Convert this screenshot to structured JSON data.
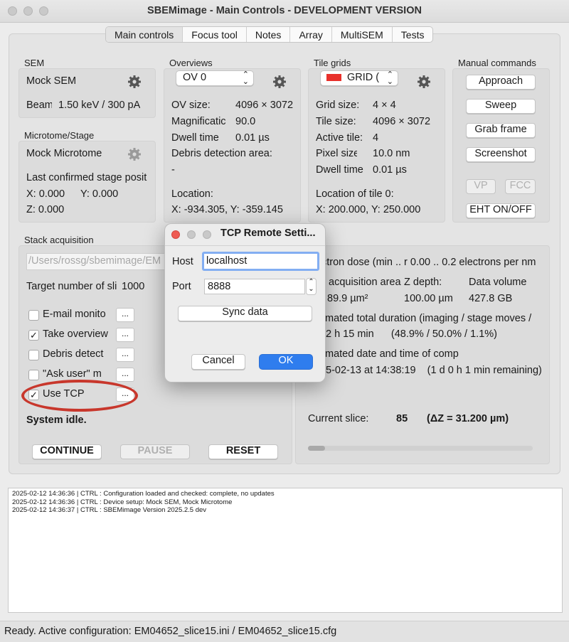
{
  "window": {
    "title": "SBEMimage - Main Controls - DEVELOPMENT VERSION"
  },
  "tabs": [
    "Main controls",
    "Focus tool",
    "Notes",
    "Array",
    "MultiSEM",
    "Tests"
  ],
  "sem": {
    "section_label": "SEM",
    "device": "Mock SEM",
    "beam_label": "Beam",
    "beam_value": "1.50 keV / 300 pA"
  },
  "stage": {
    "section_label": "Microtome/Stage",
    "device": "Mock Microtome",
    "last_pos_label": "Last confirmed stage posit",
    "x": "X: 0.000",
    "y": "Y: 0.000",
    "z": "Z: 0.000"
  },
  "overviews": {
    "section_label": "Overviews",
    "selected": "OV 0",
    "rows": [
      {
        "label": "OV size:",
        "value": "4096 × 3072"
      },
      {
        "label": "Magnificatic",
        "value": "90.0"
      },
      {
        "label": "Dwell time",
        "value": "0.01 µs"
      }
    ],
    "debris_label": "Debris detection area:",
    "debris_value": "-",
    "location_label": "Location:",
    "location_value": "X: -934.305, Y: -359.145"
  },
  "tile_grids": {
    "section_label": "Tile grids",
    "selected": "GRID (",
    "swatch_color": "#e8302b",
    "rows": [
      {
        "label": "Grid size:",
        "value": "4 × 4"
      },
      {
        "label": "Tile size:",
        "value": "4096 × 3072"
      },
      {
        "label": "Active tile:",
        "value": "4"
      },
      {
        "label": "Pixel size",
        "value": "10.0 nm"
      },
      {
        "label": "Dwell time",
        "value": "0.01 µs"
      }
    ],
    "location_label": "Location of tile 0:",
    "location_value": "X: 200.000, Y: 250.000"
  },
  "manual": {
    "section_label": "Manual commands",
    "buttons": [
      "Approach",
      "Sweep",
      "Grab frame",
      "Screenshot"
    ],
    "vp": "VP",
    "fcc": "FCC",
    "eht": "EHT ON/OFF"
  },
  "stack": {
    "section_label": "Stack acquisition",
    "path": "/Users/rossg/sbemimage/EM",
    "target_label": "Target number of sli",
    "target_value": "1000",
    "options": [
      {
        "label": "E-mail monito",
        "checked": false
      },
      {
        "label": "Take overview",
        "checked": true
      },
      {
        "label": "Debris detect",
        "checked": false
      },
      {
        "label": "\"Ask user\" m",
        "checked": false
      },
      {
        "label": "Use TCP",
        "checked": true
      }
    ],
    "dots": "...",
    "status": "System idle.",
    "continue": "CONTINUE",
    "pause": "PAUSE",
    "reset": "RESET"
  },
  "info": {
    "dose_line": "ctron dose (min .. r    0.00 .. 0.2 electrons per nm",
    "area_label": "acquisition area",
    "z_label": "Z depth:",
    "vol_label": "Data volume",
    "area_value": "89.9 µm²",
    "z_value": "100.00 µm",
    "vol_value": "427.8 GB",
    "duration_label": "mated total duration (imaging / stage moves /",
    "duration_value": "2 h 15 min      (48.9% / 50.0% / 1.1%)",
    "completion_label": "mated date and time of comp",
    "completion_value": "5-02-13 at 14:38:19    (1 d 0 h 1 min remaining)",
    "current_slice_label": "Current slice:",
    "current_slice_value": "85",
    "delta_z": "(ΔZ = 31.200 µm)"
  },
  "log": [
    "2025-02-12 14:36:36 | CTRL  : Configuration loaded and checked: complete, no updates",
    "2025-02-12 14:36:36 | CTRL  : Device setup: Mock SEM, Mock Microtome",
    "2025-02-12 14:36:37 | CTRL  : SBEMimage Version 2025.2.5 dev"
  ],
  "status_bar": "Ready. Active configuration: EM04652_slice15.ini / EM04652_slice15.cfg",
  "dialog": {
    "title": "TCP Remote Setti...",
    "host_label": "Host",
    "host_value": "localhost",
    "port_label": "Port",
    "port_value": "8888",
    "sync": "Sync data",
    "cancel": "Cancel",
    "ok": "OK"
  },
  "colors": {
    "highlight_circle": "#c8372c",
    "ok_blue": "#2f7dee",
    "close_red": "#ee5b53"
  }
}
